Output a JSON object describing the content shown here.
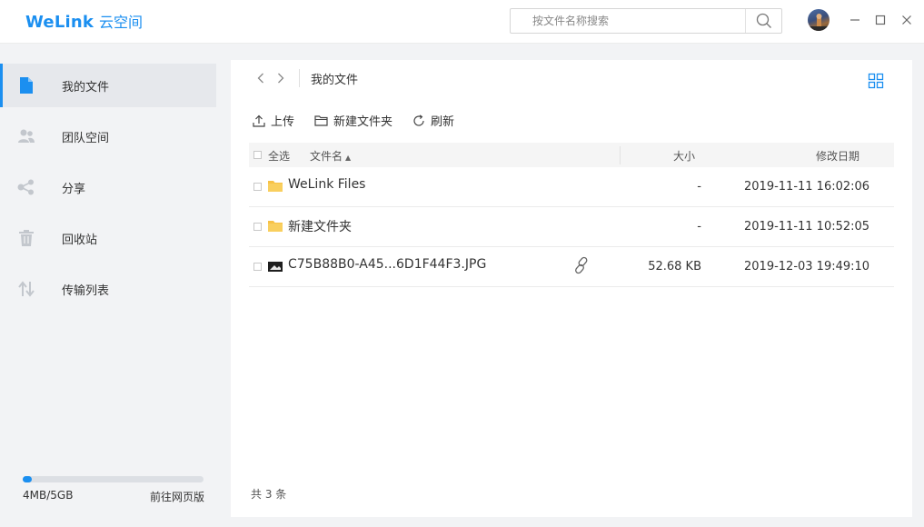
{
  "app": {
    "brand": "WeLink",
    "product": "云空间"
  },
  "search": {
    "placeholder": "按文件名称搜索"
  },
  "colors": {
    "accent": "#1b8ff0",
    "folder": "#f7c247"
  },
  "sidebar": {
    "items": [
      {
        "label": "我的文件",
        "icon": "document-icon",
        "active": true
      },
      {
        "label": "团队空间",
        "icon": "team-icon",
        "active": false
      },
      {
        "label": "分享",
        "icon": "share-icon",
        "active": false
      },
      {
        "label": "回收站",
        "icon": "trash-icon",
        "active": false
      },
      {
        "label": "传输列表",
        "icon": "transfer-icon",
        "active": false
      }
    ],
    "storage": {
      "used_label": "4MB/5GB",
      "fraction": 0.05,
      "web_link": "前往网页版"
    }
  },
  "main": {
    "breadcrumb": "我的文件",
    "toolbar": {
      "upload": "上传",
      "new_folder": "新建文件夹",
      "refresh": "刷新"
    },
    "table": {
      "headers": {
        "select_all": "全选",
        "name": "文件名",
        "size": "大小",
        "modified": "修改日期"
      },
      "rows": [
        {
          "name": "WeLink Files",
          "type": "folder",
          "size": "-",
          "modified": "2019-11-11 16:02:06"
        },
        {
          "name": "新建文件夹",
          "type": "folder",
          "size": "-",
          "modified": "2019-11-11 10:52:05"
        },
        {
          "name": "C75B88B0-A45...6D1F44F3.JPG",
          "type": "image",
          "size": "52.68 KB",
          "modified": "2019-12-03 19:49:10",
          "shared": true
        }
      ]
    },
    "count": "共 3 条"
  }
}
